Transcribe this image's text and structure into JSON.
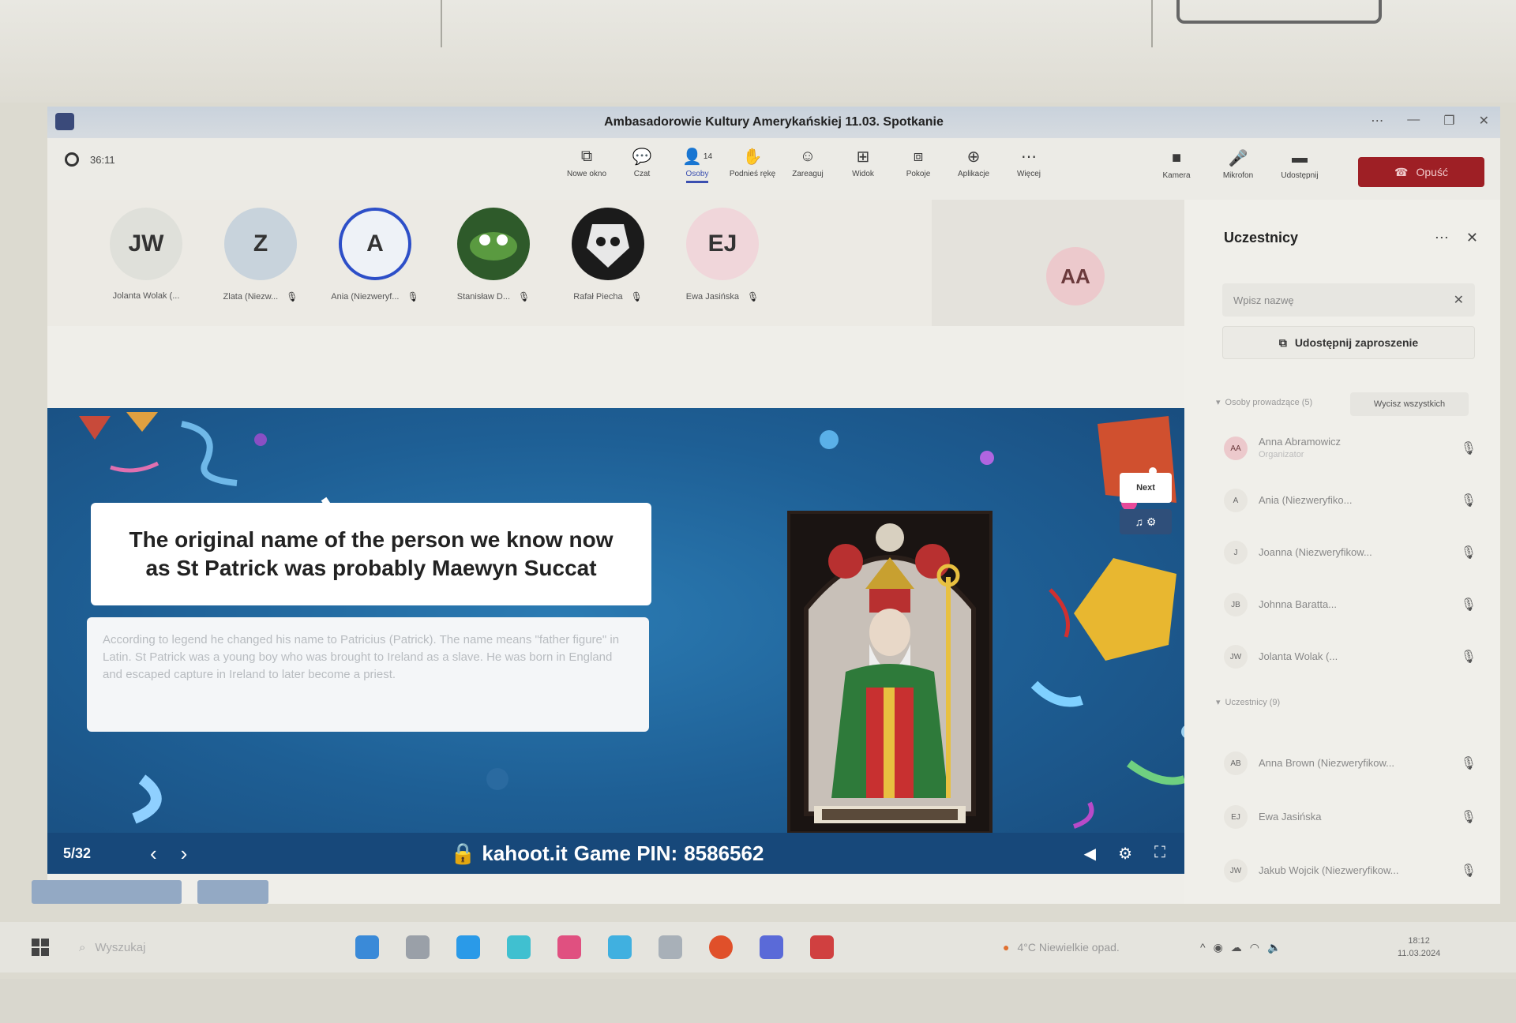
{
  "window": {
    "title": "Ambasadorowie Kultury Amerykańskiej 11.03. Spotkanie",
    "timer": "36:11"
  },
  "toolbar": {
    "items": [
      {
        "label": "Nowe okno",
        "icon": "new-window-icon",
        "glyph": "⧉"
      },
      {
        "label": "Czat",
        "icon": "chat-icon",
        "glyph": "💬"
      },
      {
        "label": "Osoby",
        "icon": "people-icon",
        "glyph": "👤",
        "badge": "14"
      },
      {
        "label": "Podnieś rękę",
        "icon": "raise-hand-icon",
        "glyph": "✋"
      },
      {
        "label": "Zareaguj",
        "icon": "react-icon",
        "glyph": "☺"
      },
      {
        "label": "Widok",
        "icon": "view-icon",
        "glyph": "⊞"
      },
      {
        "label": "Pokoje",
        "icon": "rooms-icon",
        "glyph": "⧈"
      },
      {
        "label": "Aplikacje",
        "icon": "apps-icon",
        "glyph": "⊕"
      },
      {
        "label": "Więcej",
        "icon": "more-icon",
        "glyph": "⋯"
      }
    ],
    "media": [
      {
        "label": "Kamera",
        "icon": "camera-icon",
        "glyph": "■"
      },
      {
        "label": "Mikrofon",
        "icon": "microphone-icon",
        "glyph": "🎤"
      },
      {
        "label": "Udostępnij",
        "icon": "share-icon",
        "glyph": "▬"
      }
    ],
    "leave_label": "Opuść"
  },
  "participants_strip": [
    {
      "initials": "JW",
      "name": "Jolanta Wolak (...",
      "bg": "#dfe0da"
    },
    {
      "initials": "Z",
      "name": "Zlata (Niezw...",
      "bg": "#c8d3dc"
    },
    {
      "initials": "A",
      "name": "Ania (Niezweryf...",
      "bg": "#eef2f7"
    },
    {
      "initials": "",
      "name": "Stanisław D...",
      "bg": "#2e5a2a"
    },
    {
      "initials": "",
      "name": "Rafał Piecha",
      "bg": "#1b1b1b"
    },
    {
      "initials": "EJ",
      "name": "Ewa Jasińska",
      "bg": "#f0d6da"
    }
  ],
  "aa_tile": {
    "initials": "AA"
  },
  "kahoot": {
    "question": "The original name of the person we know now as St Patrick was probably Maewyn Succat",
    "description": "According to legend he changed his name to Patricius (Patrick). The name means \"father figure\" in Latin. St Patrick was a young boy who was brought to Ireland as a slave. He was born in England and escaped capture in Ireland to later become a priest.",
    "next_label": "Next",
    "counter": "5/32",
    "site": "kahoot.it",
    "pin_label": "Game PIN:",
    "pin": "8586562"
  },
  "panel": {
    "title": "Uczestnicy",
    "search_placeholder": "Wpisz nazwę",
    "invite_label": "Udostępnij zaproszenie",
    "presenters_header": "Osoby prowadzące (5)",
    "mute_all_label": "Wycisz wszystkich",
    "attendees_header": "Uczestnicy (9)",
    "presenters": [
      {
        "initials": "AA",
        "name": "Anna Abramowicz",
        "role": "Organizator"
      },
      {
        "initials": "A",
        "name": "Ania (Niezweryfiko...",
        "role": ""
      },
      {
        "initials": "J",
        "name": "Joanna (Niezweryfikow...",
        "role": ""
      },
      {
        "initials": "JB",
        "name": "Johnna Baratta...",
        "role": ""
      },
      {
        "initials": "JW",
        "name": "Jolanta Wolak (...",
        "role": ""
      }
    ],
    "attendees": [
      {
        "initials": "AB",
        "name": "Anna Brown (Niezweryfikow...",
        "role": ""
      },
      {
        "initials": "EJ",
        "name": "Ewa Jasińska",
        "role": ""
      },
      {
        "initials": "JW",
        "name": "Jakub Wojcik (Niezweryfikow...",
        "role": ""
      }
    ]
  },
  "taskbar": {
    "search_label": "Wyszukaj",
    "weather": "4°C Niewielkie opad.",
    "time": "18:12",
    "date": "11.03.2024"
  }
}
